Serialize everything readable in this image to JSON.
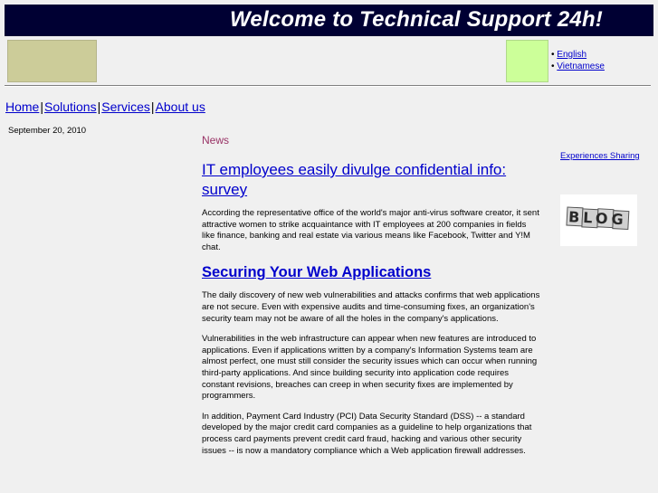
{
  "header": {
    "title": "Welcome to Technical Support 24h!"
  },
  "languages": {
    "items": [
      "English",
      "Vietnamese"
    ]
  },
  "nav": {
    "home": "Home",
    "solutions": "Solutions",
    "services": "Services",
    "about": "About us",
    "separator": "|"
  },
  "date": "September 20, 2010",
  "main": {
    "section_label": "News",
    "article1": {
      "title": "IT employees easily divulge confidential info: survey",
      "body": "According the representative office of the world's major anti-virus software creator, it sent attractive women to strike acquaintance with IT employees at 200 companies in fields like finance,  banking and real estate via various means like Facebook, Twitter and Y!M chat."
    },
    "article2": {
      "title": "Securing Your Web Applications",
      "paragraphs": [
        "The daily discovery of new web vulnerabilities and attacks confirms that web applications are not secure. Even with expensive audits and time-consuming fixes, an organization's security team may not be aware of all the holes in the company's applications.",
        "Vulnerabilities in the web infrastructure can appear when new features are introduced to applications. Even if applications written by a company's Information Systems team are almost perfect, one must still consider the security issues which can occur when running third-party applications. And since building security into application code requires constant revisions, breaches can creep in when security fixes are implemented by programmers.",
        "In addition, Payment Card Industry (PCI) Data Security Standard (DSS) -- a standard developed by the major credit card companies as a guideline to help organizations that process card payments prevent credit card fraud, hacking and various other security issues -- is now a mandatory compliance which a Web application firewall addresses."
      ]
    }
  },
  "sidebar": {
    "link": "Experiences Sharing",
    "blog_image_text": "BLOG"
  },
  "colors": {
    "banner_bg": "#000033",
    "link": "#0000cc",
    "news_label": "#993366",
    "logo_box": "#cccc99",
    "green_box": "#ccff99"
  }
}
